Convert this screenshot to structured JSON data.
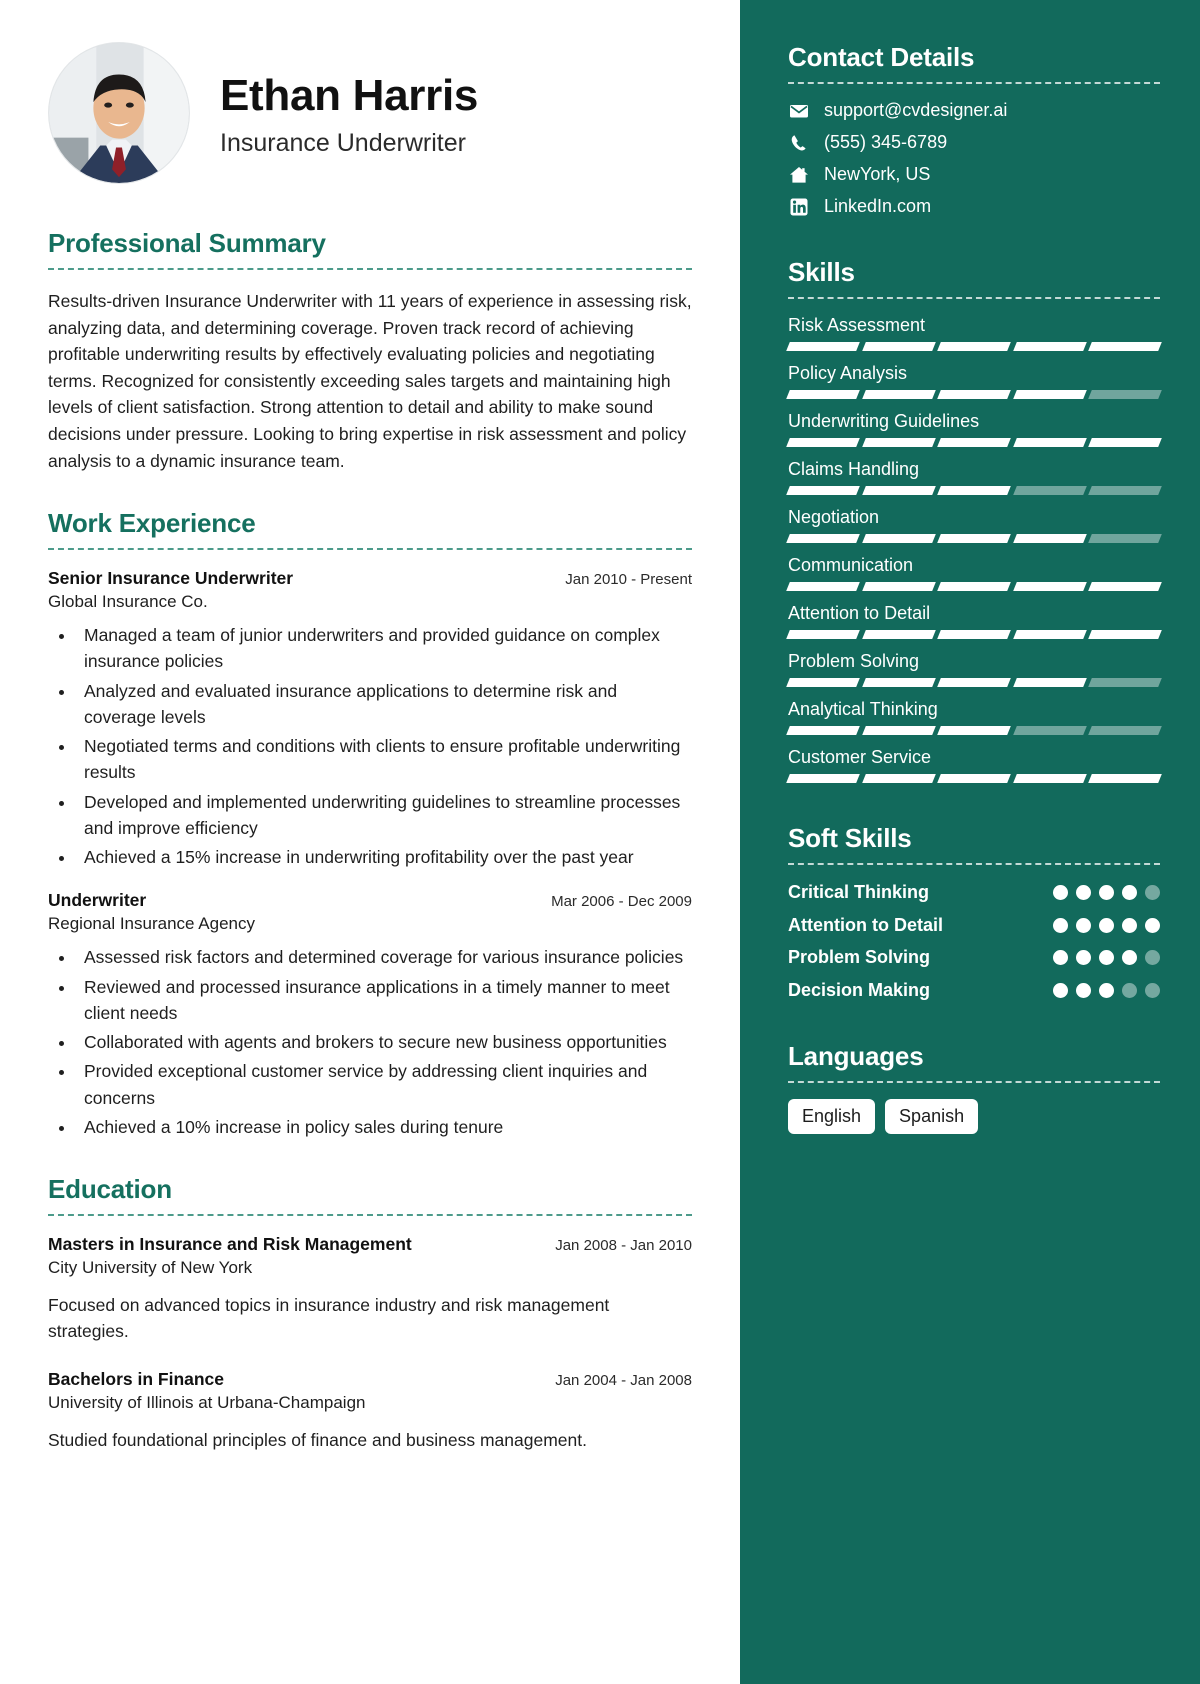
{
  "theme": {
    "accent": "#15705f",
    "sidebar_bg": "#126a5c",
    "text": "#1f1f1f",
    "chip_bg": "#ffffff"
  },
  "header": {
    "name": "Ethan Harris",
    "job_title": "Insurance Underwriter",
    "avatar_icon": "profile-photo"
  },
  "summary": {
    "title": "Professional Summary",
    "text": "Results-driven Insurance Underwriter with 11 years of experience in assessing risk, analyzing data, and determining coverage. Proven track record of achieving profitable underwriting results by effectively evaluating policies and negotiating terms. Recognized for consistently exceeding sales targets and maintaining high levels of client satisfaction. Strong attention to detail and ability to make sound decisions under pressure. Looking to bring expertise in risk assessment and policy analysis to a dynamic insurance team."
  },
  "work": {
    "title": "Work Experience",
    "entries": [
      {
        "role": "Senior Insurance Underwriter",
        "company": "Global Insurance Co.",
        "date": "Jan 2010 - Present",
        "bullets": [
          "Managed a team of junior underwriters and provided guidance on complex insurance policies",
          "Analyzed and evaluated insurance applications to determine risk and coverage levels",
          "Negotiated terms and conditions with clients to ensure profitable underwriting results",
          "Developed and implemented underwriting guidelines to streamline processes and improve efficiency",
          "Achieved a 15% increase in underwriting profitability over the past year"
        ]
      },
      {
        "role": "Underwriter",
        "company": "Regional Insurance Agency",
        "date": "Mar 2006 - Dec 2009",
        "bullets": [
          "Assessed risk factors and determined coverage for various insurance policies",
          "Reviewed and processed insurance applications in a timely manner to meet client needs",
          "Collaborated with agents and brokers to secure new business opportunities",
          "Provided exceptional customer service by addressing client inquiries and concerns",
          "Achieved a 10% increase in policy sales during tenure"
        ]
      }
    ]
  },
  "education": {
    "title": "Education",
    "entries": [
      {
        "degree": "Masters in Insurance and Risk Management",
        "school": "City University of New York",
        "date": "Jan 2008 - Jan 2010",
        "description": "Focused on advanced topics in insurance industry and risk management strategies."
      },
      {
        "degree": "Bachelors in Finance",
        "school": "University of Illinois at Urbana-Champaign",
        "date": "Jan 2004 - Jan 2008",
        "description": "Studied foundational principles of finance and business management."
      }
    ]
  },
  "contact": {
    "title": "Contact Details",
    "items": [
      {
        "icon": "envelope-icon",
        "value": "support@cvdesigner.ai"
      },
      {
        "icon": "phone-icon",
        "value": "(555) 345-6789"
      },
      {
        "icon": "home-icon",
        "value": "NewYork, US"
      },
      {
        "icon": "linkedin-icon",
        "value": "LinkedIn.com"
      }
    ]
  },
  "skills": {
    "title": "Skills",
    "segments_total": 5,
    "items": [
      {
        "name": "Risk Assessment",
        "filled": 5
      },
      {
        "name": "Policy Analysis",
        "filled": 4
      },
      {
        "name": "Underwriting Guidelines",
        "filled": 5
      },
      {
        "name": "Claims Handling",
        "filled": 3
      },
      {
        "name": "Negotiation",
        "filled": 4
      },
      {
        "name": "Communication",
        "filled": 5
      },
      {
        "name": "Attention to Detail",
        "filled": 5
      },
      {
        "name": "Problem Solving",
        "filled": 4
      },
      {
        "name": "Analytical Thinking",
        "filled": 3
      },
      {
        "name": "Customer Service",
        "filled": 5
      }
    ]
  },
  "soft_skills": {
    "title": "Soft Skills",
    "dots_total": 5,
    "items": [
      {
        "name": "Critical Thinking",
        "filled": 4
      },
      {
        "name": "Attention to Detail",
        "filled": 5
      },
      {
        "name": "Problem Solving",
        "filled": 4
      },
      {
        "name": "Decision Making",
        "filled": 3
      }
    ]
  },
  "languages": {
    "title": "Languages",
    "items": [
      "English",
      "Spanish"
    ]
  }
}
